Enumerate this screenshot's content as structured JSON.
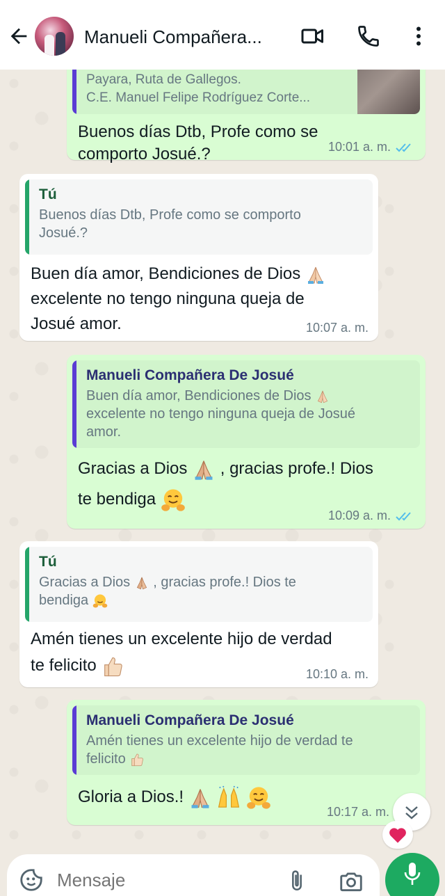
{
  "header": {
    "title": "Manueli Compañera..."
  },
  "messages": [
    {
      "id": "m1",
      "direction": "out",
      "quote_line1": "Payara, Ruta de Gallegos.",
      "quote_line2": "C.E. Manuel Felipe Rodríguez Corte...",
      "text_line1": "Buenos días Dtb,  Profe como se",
      "text_line2": "comporto Josué.?",
      "time": "10:01 a. m."
    },
    {
      "id": "m2",
      "direction": "in",
      "quote_author": "Tú",
      "quote_line1": "Buenos días Dtb,  Profe como se comporto",
      "quote_line2": "Josué.?",
      "text_line1": "Buen día amor, Bendiciones de Dios",
      "text_line2": "excelente no tengo ninguna queja de",
      "text_line3": "Josué amor.",
      "time": "10:07 a. m."
    },
    {
      "id": "m3",
      "direction": "out",
      "quote_author": "Manueli Compañera De Josué",
      "quote_line1": "Buen día amor, Bendiciones de Dios",
      "quote_line2": "excelente no tengo ninguna queja de Josué",
      "quote_line3": "amor.",
      "text_line1a": "Gracias a Dios",
      "text_line1b": ",  gracias profe.! Dios",
      "text_line2": "te bendiga",
      "time": "10:09 a. m."
    },
    {
      "id": "m4",
      "direction": "in",
      "quote_author": "Tú",
      "quote_line1a": "Gracias a Dios",
      "quote_line1b": ",  gracias profe.! Dios te",
      "quote_line2": "bendiga",
      "text_line1": "Amén tienes un excelente hijo de verdad",
      "text_line2": "te felicito",
      "time": "10:10 a. m."
    },
    {
      "id": "m5",
      "direction": "out",
      "quote_author": "Manueli Compañera De Josué",
      "quote_line1": "Amén tienes un excelente hijo de verdad te",
      "quote_line2": "felicito",
      "text_line1": "Gloria a Dios.!",
      "time": "10:17 a. m."
    }
  ],
  "composer": {
    "placeholder": "Mensaje"
  },
  "colors": {
    "outgoing_bubble": "#d9fdd3",
    "incoming_bubble": "#ffffff",
    "read_ticks": "#53bdeb",
    "mic_button": "#1daa61",
    "reaction_heart": "#e0245e"
  }
}
